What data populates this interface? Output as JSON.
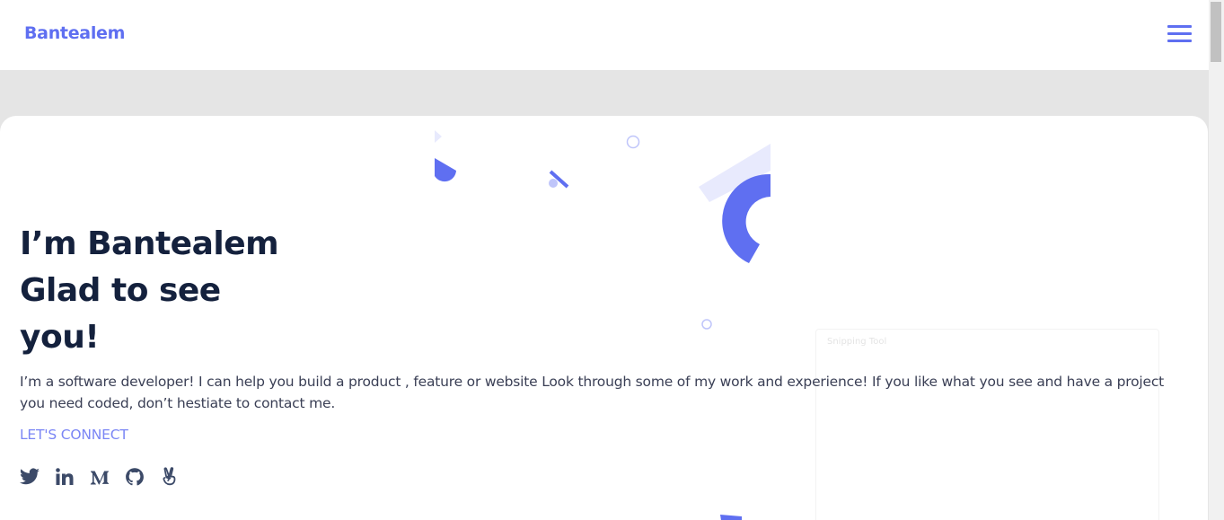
{
  "navbar": {
    "brand": "Bantealem",
    "menu_icon": "hamburger-menu-icon"
  },
  "hero": {
    "headline_lines": [
      "I’m Bantealem",
      "Glad to see",
      "you!"
    ],
    "intro": "I’m a software developer! I can help you build a product , feature or website Look through some of my work and experience! If you like what you see and have a project you need coded, don’t hestiate to contact me.",
    "cta_label": "LET'S CONNECT",
    "socials": [
      {
        "icon": "twitter-icon"
      },
      {
        "icon": "linkedin-icon"
      },
      {
        "icon": "medium-icon"
      },
      {
        "icon": "github-icon"
      },
      {
        "icon": "angellist-icon"
      }
    ]
  },
  "overlay": {
    "title": "Snipping Tool"
  },
  "colors": {
    "accent": "#5f6ff1",
    "accent_light": "#e8eafd",
    "heading": "#14213d",
    "body_text": "#3a3f55",
    "page_bg": "#e5e5e5",
    "icon": "#3c4a68"
  }
}
